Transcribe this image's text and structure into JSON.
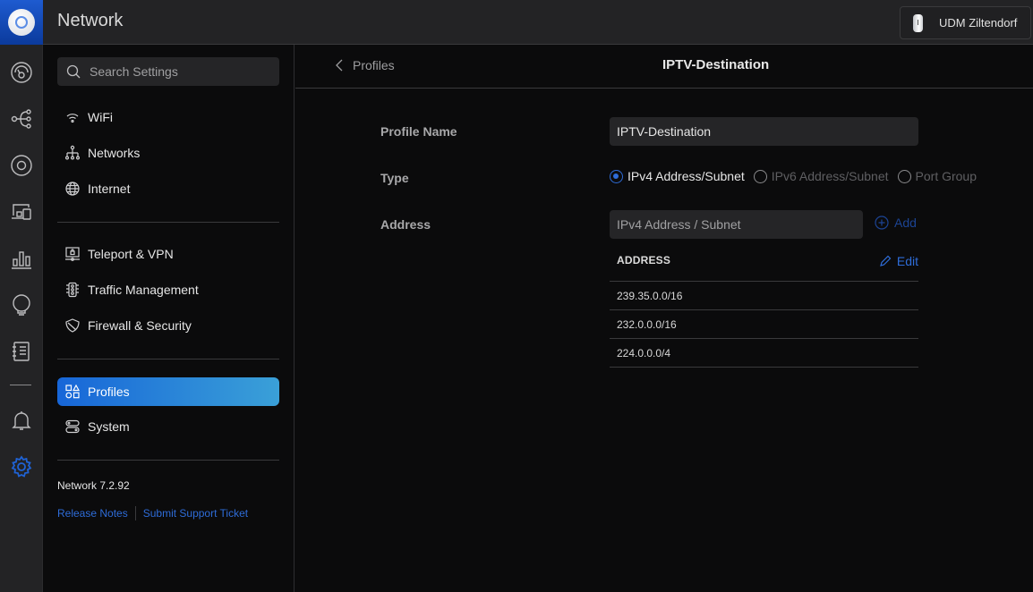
{
  "header": {
    "app_title": "Network",
    "device_name": "UDM Ziltendorf"
  },
  "rail": {
    "items": [
      {
        "icon": "dashboard-icon",
        "label": "Dashboard"
      },
      {
        "icon": "topology-icon",
        "label": "Topology"
      },
      {
        "icon": "unifi-devices-icon",
        "label": "UniFi Devices"
      },
      {
        "icon": "client-devices-icon",
        "label": "Client Devices"
      },
      {
        "icon": "statistics-icon",
        "label": "Statistics"
      },
      {
        "icon": "insights-icon",
        "label": "Insights"
      },
      {
        "icon": "logs-icon",
        "label": "System Log"
      },
      {
        "icon": "notifications-icon",
        "label": "Notifications"
      },
      {
        "icon": "settings-icon",
        "label": "Settings",
        "active": true
      }
    ]
  },
  "sidebar": {
    "search_placeholder": "Search Settings",
    "groups": [
      [
        {
          "icon": "wifi-icon",
          "label": "WiFi"
        },
        {
          "icon": "networks-icon",
          "label": "Networks"
        },
        {
          "icon": "globe-icon",
          "label": "Internet"
        }
      ],
      [
        {
          "icon": "teleport-vpn-icon",
          "label": "Teleport & VPN"
        },
        {
          "icon": "traffic-light-icon",
          "label": "Traffic Management"
        },
        {
          "icon": "shield-icon",
          "label": "Firewall & Security"
        }
      ],
      [
        {
          "icon": "profiles-icon",
          "label": "Profiles",
          "active": true
        },
        {
          "icon": "system-icon",
          "label": "System"
        }
      ]
    ],
    "version": "Network 7.2.92",
    "release_notes": "Release Notes",
    "support_ticket": "Submit Support Ticket"
  },
  "main": {
    "back_label": "Profiles",
    "title": "IPTV-Destination",
    "form": {
      "profile_name_label": "Profile Name",
      "profile_name_value": "IPTV-Destination",
      "type_label": "Type",
      "type_options": [
        {
          "label": "IPv4 Address/Subnet",
          "checked": true
        },
        {
          "label": "IPv6 Address/Subnet",
          "checked": false
        },
        {
          "label": "Port Group",
          "checked": false
        }
      ],
      "address_label": "Address",
      "address_placeholder": "IPv4 Address / Subnet",
      "add_label": "Add"
    },
    "table": {
      "header": "ADDRESS",
      "edit_label": "Edit",
      "rows": [
        "239.35.0.0/16",
        "232.0.0.0/16",
        "224.0.0.0/4"
      ]
    }
  },
  "colors": {
    "accent": "#2e6cd8",
    "active_gradient_start": "#1766d8",
    "active_gradient_end": "#3aa0d8"
  }
}
